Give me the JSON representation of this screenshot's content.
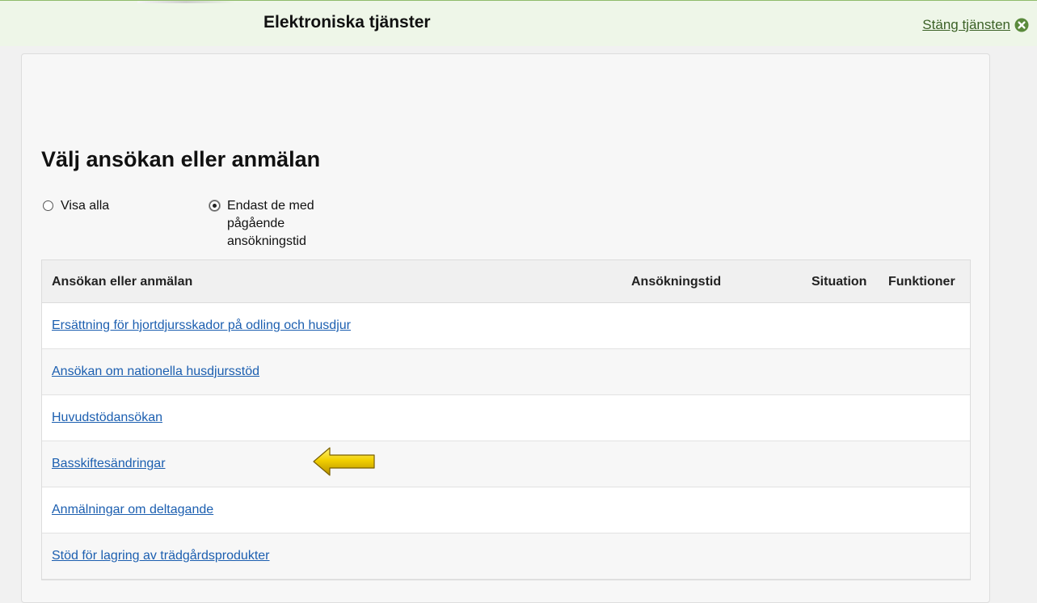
{
  "header": {
    "title": "Elektroniska tjänster",
    "close_label": "Stäng tjänsten",
    "close_icon": "close-circle-icon"
  },
  "page": {
    "title": "Välj ansökan eller anmälan"
  },
  "filters": [
    {
      "label": "Visa alla",
      "checked": false
    },
    {
      "label": "Endast de med pågående ansökningstid",
      "checked": true
    }
  ],
  "table": {
    "columns": [
      "Ansökan eller anmälan",
      "Ansökningstid",
      "Situation",
      "Funktioner"
    ],
    "rows": [
      {
        "name": "Ersättning för hjortdjursskador på odling och husdjur",
        "period": "",
        "situation": "",
        "functions": ""
      },
      {
        "name": "Ansökan om nationella husdjursstöd",
        "period": "",
        "situation": "",
        "functions": ""
      },
      {
        "name": "Huvudstödansökan",
        "period": "",
        "situation": "",
        "functions": ""
      },
      {
        "name": "Basskiftesändringar",
        "period": "",
        "situation": "",
        "functions": ""
      },
      {
        "name": "Anmälningar om deltagande",
        "period": "",
        "situation": "",
        "functions": ""
      },
      {
        "name": "Stöd för lagring av trädgårdsprodukter",
        "period": "",
        "situation": "",
        "functions": ""
      }
    ]
  },
  "annotation": {
    "icon": "yellow-arrow-left-icon",
    "color": "#f2d000"
  },
  "colors": {
    "header_bg": "#eef6e8",
    "close_link": "#3b6126",
    "link": "#1c5fb0"
  }
}
